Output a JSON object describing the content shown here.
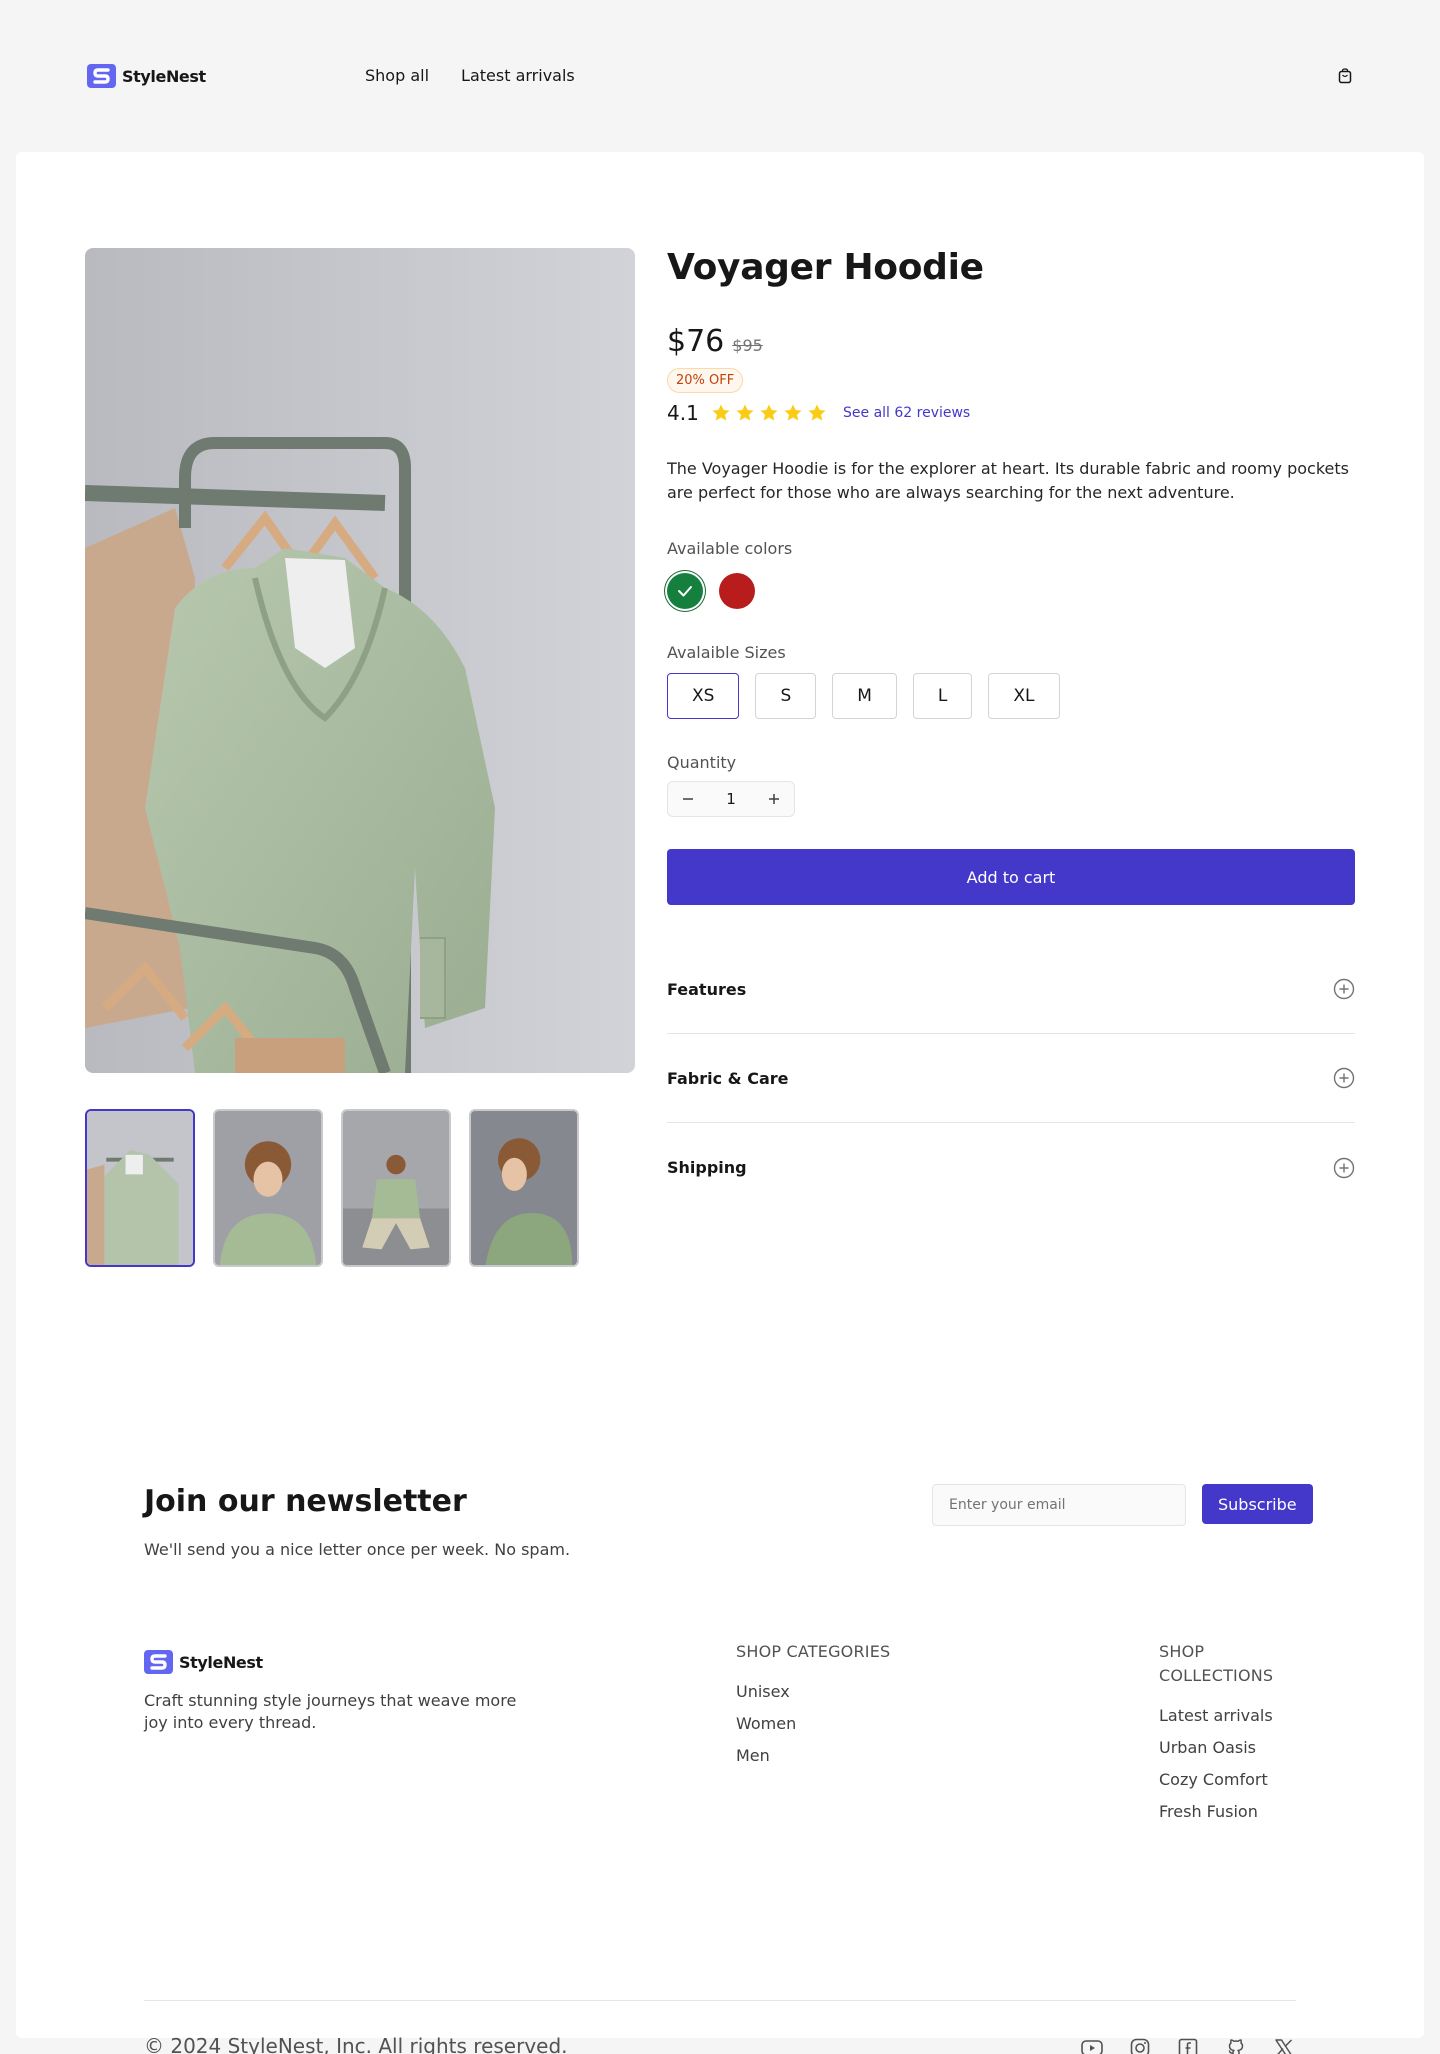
{
  "brand": {
    "name": "StyleNest",
    "accent_color": "#4338ca",
    "logo_color": "#6366f1"
  },
  "header": {
    "nav": [
      {
        "label": "Shop all"
      },
      {
        "label": "Latest arrivals"
      }
    ],
    "cart_icon": "shopping-bag-icon"
  },
  "product": {
    "title": "Voyager Hoodie",
    "price": "$76",
    "old_price": "$95",
    "discount_badge": "20% OFF",
    "rating": "4.1",
    "stars": 5,
    "reviews_link": "See all 62 reviews",
    "description": "The Voyager Hoodie is for the explorer at heart. Its durable fabric and roomy pockets are perfect for those who are always searching for the next adventure.",
    "colors_label": "Available colors",
    "colors": [
      {
        "name": "Green",
        "hex": "#15803d",
        "selected": true
      },
      {
        "name": "Red",
        "hex": "#b91c1c",
        "selected": false
      }
    ],
    "sizes_label": "Avalaible Sizes",
    "sizes": [
      "XS",
      "S",
      "M",
      "L",
      "XL"
    ],
    "selected_size": "XS",
    "quantity_label": "Quantity",
    "quantity": "1",
    "add_to_cart": "Add to cart",
    "accordion": [
      {
        "title": "Features"
      },
      {
        "title": "Fabric & Care"
      },
      {
        "title": "Shipping"
      }
    ],
    "thumbnails": [
      "hoodie-on-rack",
      "model-portrait",
      "model-sitting",
      "model-side"
    ]
  },
  "newsletter": {
    "title": "Join our newsletter",
    "subtitle": "We'll send you a nice letter once per week. No spam.",
    "placeholder": "Enter your email",
    "button": "Subscribe"
  },
  "footer": {
    "tagline": "Craft stunning style journeys that weave more joy into every thread.",
    "categories_title": "SHOP CATEGORIES",
    "categories": [
      "Unisex",
      "Women",
      "Men"
    ],
    "collections_title": "SHOP COLLECTIONS",
    "collections": [
      "Latest arrivals",
      "Urban Oasis",
      "Cozy Comfort",
      "Fresh Fusion"
    ],
    "copyright": "© 2024 StyleNest, Inc. All rights reserved.",
    "socials": [
      "youtube-icon",
      "instagram-icon",
      "facebook-icon",
      "github-icon",
      "x-icon"
    ]
  }
}
